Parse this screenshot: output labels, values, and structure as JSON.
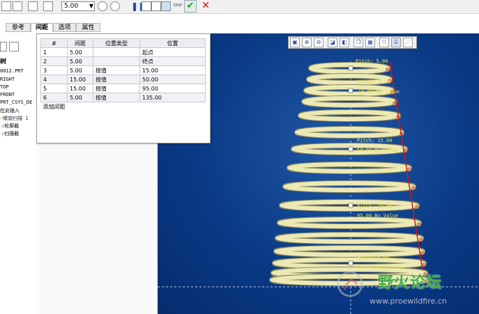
{
  "toolbar": {
    "value": "5.00"
  },
  "tabs": [
    {
      "label": "参考",
      "active": false
    },
    {
      "label": "间距",
      "active": true
    },
    {
      "label": "选项",
      "active": false
    },
    {
      "label": "属性",
      "active": false
    }
  ],
  "tree": {
    "header": "树",
    "items": [
      "0012.PRT",
      "RIGHT",
      "TOP",
      "FRONT",
      "PRT_CSYS_DE",
      "在此插入",
      "螺旋扫描 1",
      "轮廓截",
      "扫描截"
    ]
  },
  "pitch_table": {
    "columns": [
      "#",
      "间距",
      "位置类型",
      "位置"
    ],
    "rows": [
      [
        "1",
        "5.00",
        "",
        "起点"
      ],
      [
        "2",
        "5.00",
        "",
        "终点"
      ],
      [
        "3",
        "5.00",
        "按值",
        "15.00"
      ],
      [
        "4",
        "15.00",
        "按值",
        "50.00"
      ],
      [
        "5",
        "15.00",
        "按值",
        "95.00"
      ],
      [
        "6",
        "5.00",
        "按值",
        "135.00"
      ]
    ],
    "add_label": "添加间距"
  },
  "viewport": {
    "labels": [
      "Pitch: 5.00",
      "Pitch: 5.00",
      "15.00 By Value",
      "Pitch: 15.00",
      "50.00 By Value",
      "Pitch: 15.00",
      "95.00 By Value",
      "Pitch: 5.00",
      "135.00 By Value"
    ]
  },
  "watermark": {
    "title": "野火论坛",
    "url": "www.proewildfire.cn"
  },
  "colors": {
    "viewport_bg": "#0a3a86",
    "spring": "#ece9b4",
    "annotation": "#e8e04a",
    "profile_line": "#d01818",
    "watermark_green": "#3fae3f"
  }
}
